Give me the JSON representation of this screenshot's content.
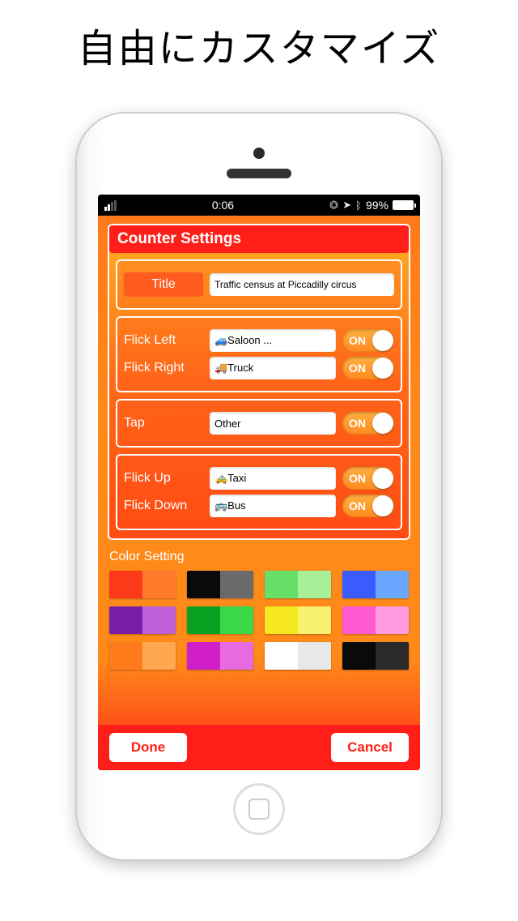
{
  "headline": "自由にカスタマイズ",
  "status": {
    "time": "0:06",
    "battery_pct": "99%"
  },
  "panel_title": "Counter Settings",
  "title_section": {
    "label": "Title",
    "value": "Traffic census at Piccadilly circus"
  },
  "gestures": {
    "flick_left": {
      "label": "Flick Left",
      "value": "🚙Saloon ...",
      "toggle": "ON"
    },
    "flick_right": {
      "label": "Flick Right",
      "value": "🚚Truck",
      "toggle": "ON"
    },
    "tap": {
      "label": "Tap",
      "value": "Other",
      "toggle": "ON"
    },
    "flick_up": {
      "label": "Flick Up",
      "value": "🚕Taxi",
      "toggle": "ON"
    },
    "flick_down": {
      "label": "Flick Down",
      "value": "🚌Bus",
      "toggle": "ON"
    }
  },
  "color_section": {
    "title": "Color Setting"
  },
  "swatches": [
    {
      "a": "#ff3a1a",
      "b": "#ff7a2a"
    },
    {
      "a": "#0a0a0a",
      "b": "#6a6a6a"
    },
    {
      "a": "#66e066",
      "b": "#a8f098"
    },
    {
      "a": "#3a5cff",
      "b": "#6aa8ff"
    },
    {
      "a": "#7a1ea8",
      "b": "#c060d8"
    },
    {
      "a": "#0aa020",
      "b": "#3ad84a"
    },
    {
      "a": "#f5e820",
      "b": "#f8f070"
    },
    {
      "a": "#ff5ad0",
      "b": "#ff9ae0"
    },
    {
      "a": "#ff7a1a",
      "b": "#ffa850"
    },
    {
      "a": "#d01ec8",
      "b": "#e86ae0"
    },
    {
      "a": "#ffffff",
      "b": "#e8e8e8"
    },
    {
      "a": "#0a0a0a",
      "b": "#2a2a2a"
    }
  ],
  "buttons": {
    "done": "Done",
    "cancel": "Cancel"
  }
}
